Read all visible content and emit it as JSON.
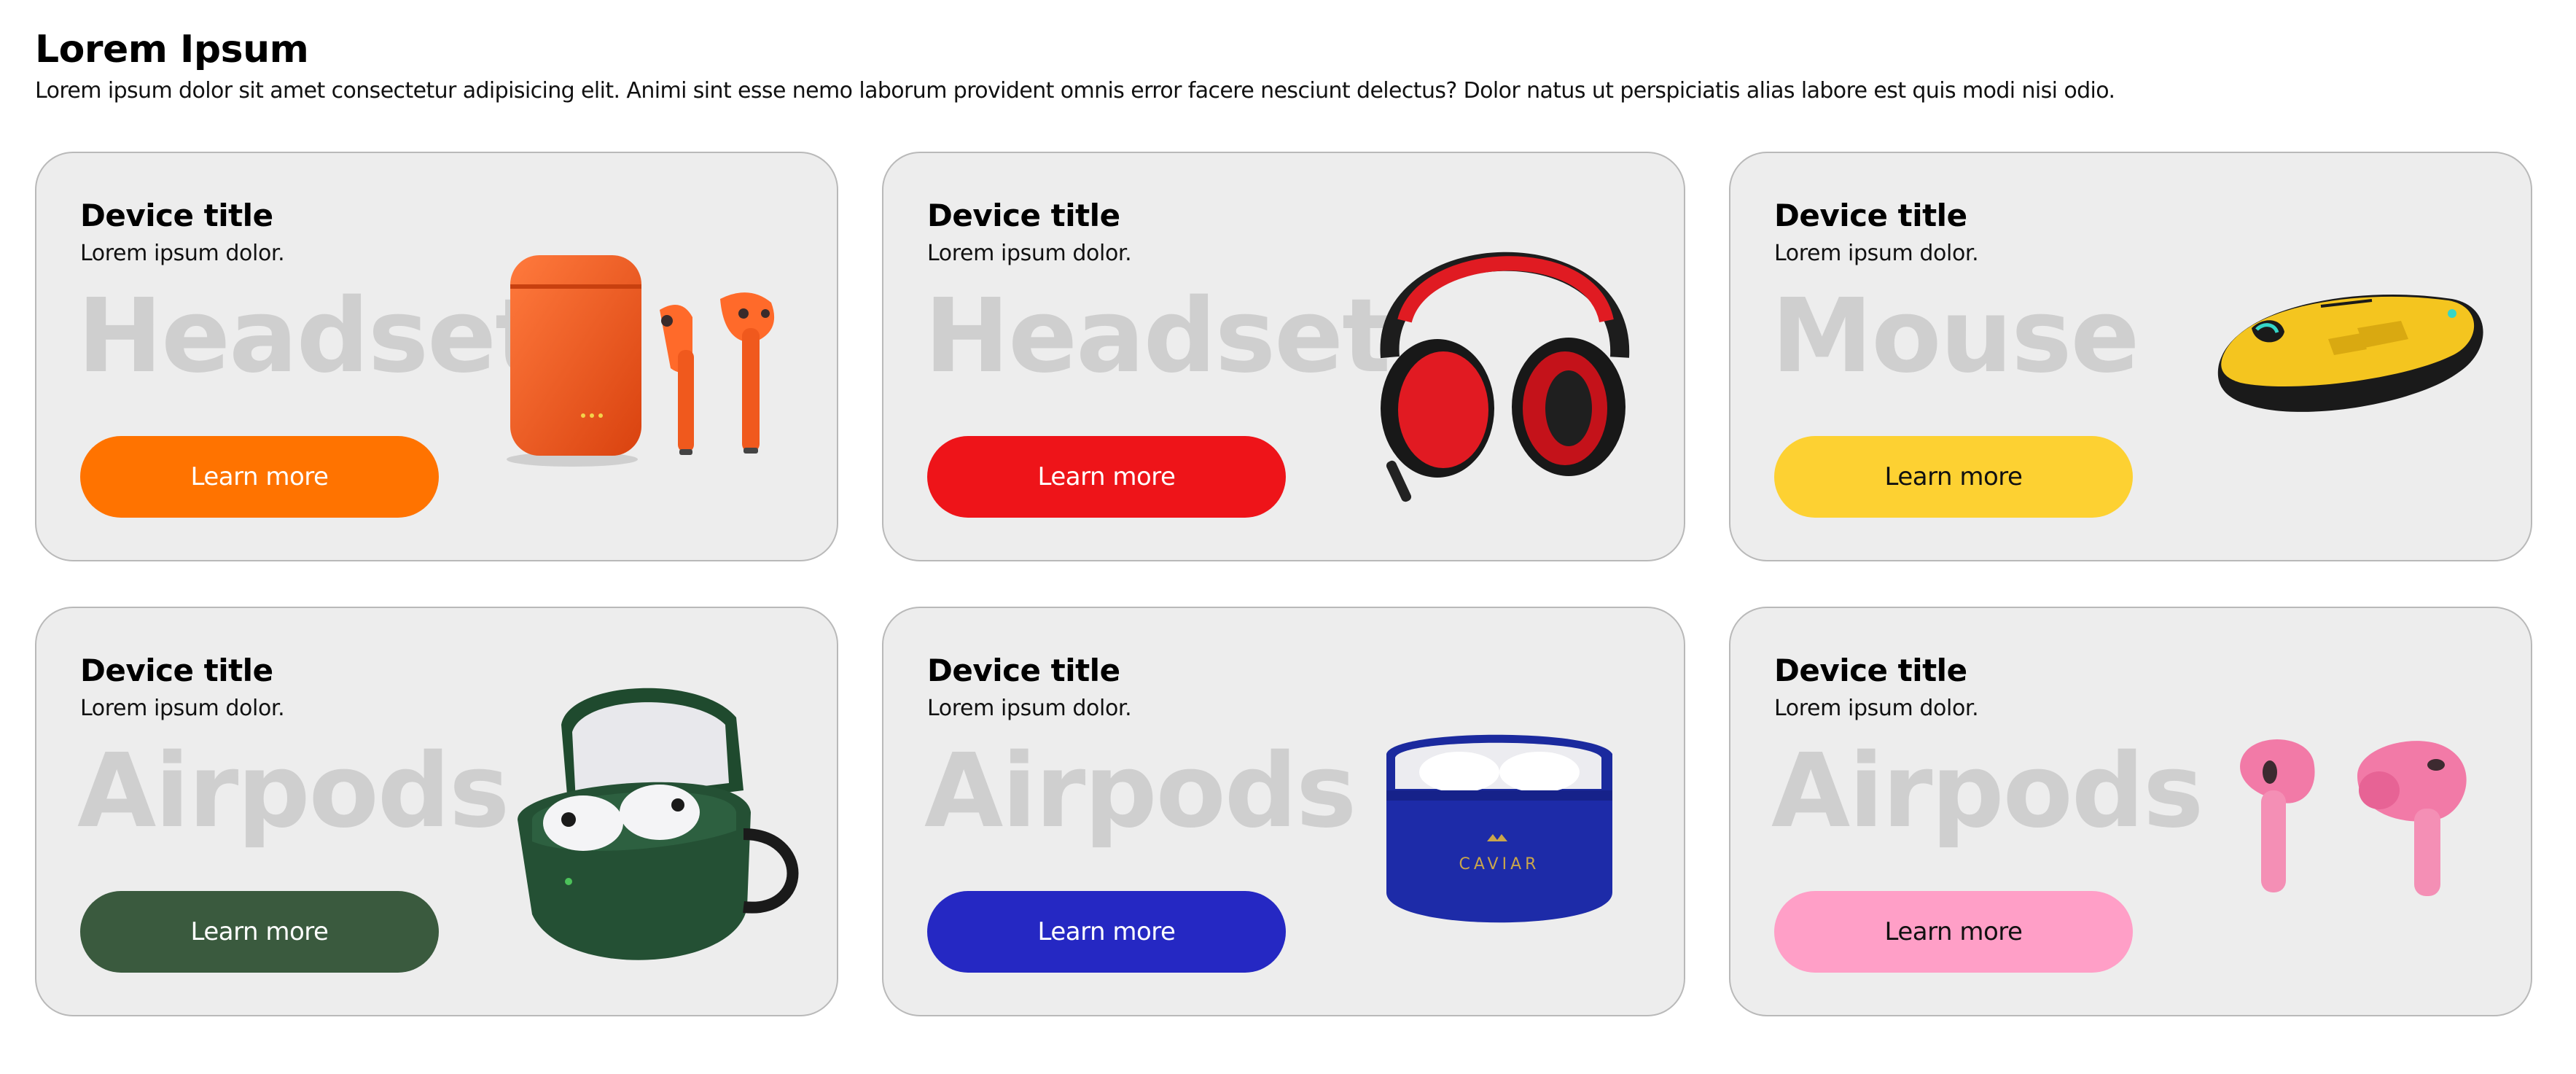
{
  "header": {
    "title": "Lorem Ipsum",
    "description": "Lorem ipsum dolor sit amet consectetur adipisicing elit. Animi sint esse nemo laborum provident omnis error facere nesciunt delectus? Dolor natus ut perspiciatis alias labore est quis modi nisi odio."
  },
  "cards": [
    {
      "title": "Device title",
      "subtitle": "Lorem ipsum dolor.",
      "watermark": "Headset",
      "button": "Learn more",
      "accent": "#ff7300",
      "button_text_color": "#ffffff",
      "icon": "orange-airpods-case-icon"
    },
    {
      "title": "Device title",
      "subtitle": "Lorem ipsum dolor.",
      "watermark": "Headset",
      "button": "Learn more",
      "accent": "#ee1419",
      "button_text_color": "#ffffff",
      "icon": "red-headphones-icon"
    },
    {
      "title": "Device title",
      "subtitle": "Lorem ipsum dolor.",
      "watermark": "Mouse",
      "button": "Learn more",
      "accent": "#fdd132",
      "button_text_color": "#111111",
      "icon": "yellow-mouse-icon"
    },
    {
      "title": "Device title",
      "subtitle": "Lorem ipsum dolor.",
      "watermark": "Airpods",
      "button": "Learn more",
      "accent": "#3a5a3e",
      "button_text_color": "#ffffff",
      "icon": "green-airpods-case-icon"
    },
    {
      "title": "Device title",
      "subtitle": "Lorem ipsum dolor.",
      "watermark": "Airpods",
      "button": "Learn more",
      "accent": "#2528c3",
      "button_text_color": "#ffffff",
      "icon": "blue-caviar-airpods-case-icon",
      "case_brand": "CAVIAR"
    },
    {
      "title": "Device title",
      "subtitle": "Lorem ipsum dolor.",
      "watermark": "Airpods",
      "button": "Learn more",
      "accent": "#ff9fc7",
      "button_text_color": "#111111",
      "icon": "pink-airpods-icon"
    }
  ]
}
